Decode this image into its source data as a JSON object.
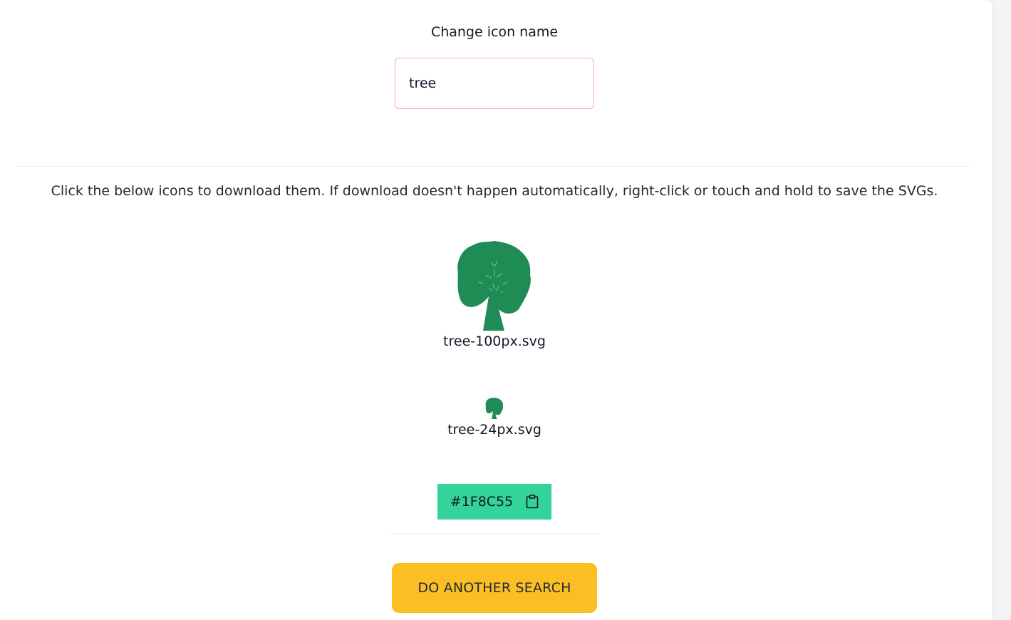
{
  "form": {
    "label": "Change icon name",
    "value": "tree"
  },
  "instructions": "Click the below icons to download them. If download doesn't happen automatically, right-click or touch and hold to save the SVGs.",
  "icons": [
    {
      "filename": "tree-100px.svg",
      "icon": "tree-icon"
    },
    {
      "filename": "tree-24px.svg",
      "icon": "tree-icon"
    }
  ],
  "color": {
    "hex": "#1F8C55",
    "copy_icon": "clipboard-icon",
    "chip_color": "#34d399"
  },
  "actions": {
    "search_again": "DO ANOTHER SEARCH",
    "button_color": "#fbbf24"
  }
}
